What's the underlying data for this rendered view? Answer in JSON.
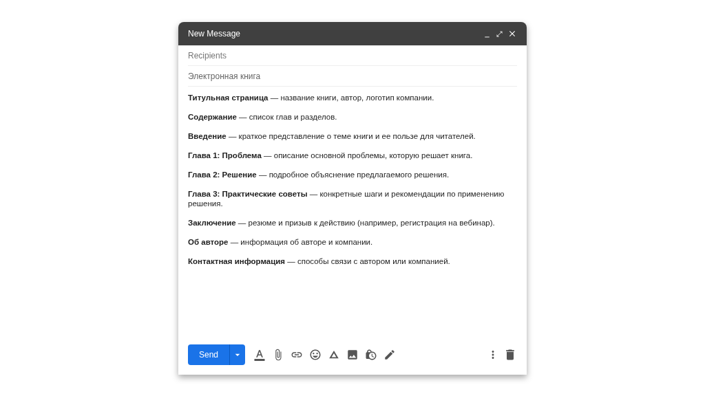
{
  "window": {
    "title": "New Message"
  },
  "recipients": {
    "placeholder": "Recipients"
  },
  "subject": {
    "value": "Электронная книга"
  },
  "body": [
    "**Титульная страница** — название книги, автор, логотип компании.",
    "**Содержание** — список глав и разделов.",
    "**Введение** — краткое представление о теме книги и ее пользе для читателей.",
    "**Глава 1: Проблема** — описание основной проблемы, которую решает книга.",
    "**Глава 2: Решение** — подробное объяснение предлагаемого решения.",
    "**Глава 3: Практические советы** — конкретные шаги и рекомендации по применению решения.",
    "**Заключение** — резюме и призыв к действию (например, регистрация на вебинар).",
    "**Об авторе** — информация об авторе и компании.",
    "**Контактная информация** — способы связи с автором или компанией."
  ],
  "send_button": {
    "label": "Send"
  }
}
